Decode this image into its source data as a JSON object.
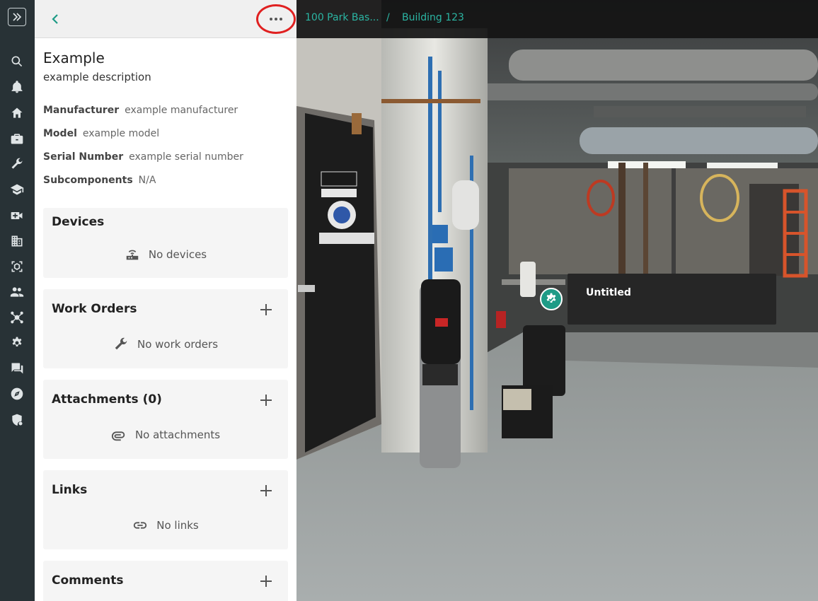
{
  "panel": {
    "title": "Example",
    "description": "example description",
    "properties": [
      {
        "label": "Manufacturer",
        "value": "example manufacturer"
      },
      {
        "label": "Model",
        "value": "example model"
      },
      {
        "label": "Serial Number",
        "value": "example serial number"
      },
      {
        "label": "Subcomponents",
        "value": "N/A"
      }
    ],
    "sections": {
      "devices": {
        "title": "Devices",
        "empty": "No devices"
      },
      "work_orders": {
        "title": "Work Orders",
        "empty": "No work orders"
      },
      "attachments": {
        "title": "Attachments (0)",
        "empty": "No attachments"
      },
      "links": {
        "title": "Links",
        "empty": "No links"
      },
      "comments": {
        "title": "Comments"
      }
    }
  },
  "breadcrumb": {
    "items": [
      "100 Park Bas...",
      "Building 123"
    ],
    "separator": "/"
  },
  "tag": {
    "title": "Untitled"
  },
  "colors": {
    "accent": "#2bb5a3",
    "rail": "#283236",
    "highlight": "#e02020"
  }
}
